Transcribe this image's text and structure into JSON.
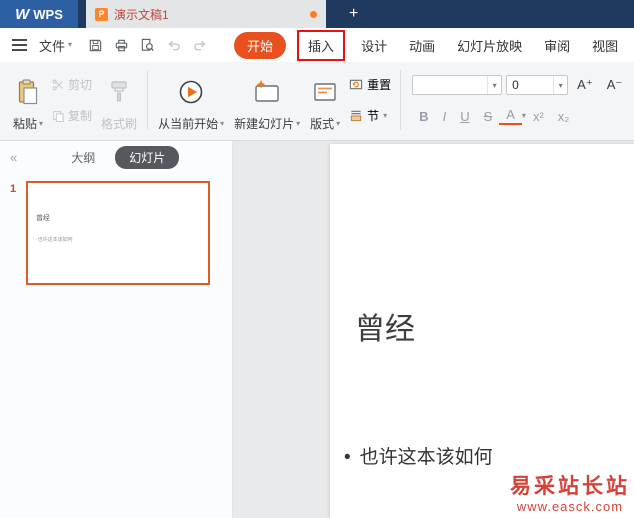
{
  "icons": {
    "logo_w": "W",
    "presentation_glyph": "P",
    "plus": "+",
    "dropdown_arrow": "▾",
    "collapse": "«"
  },
  "titlebar": {
    "logo_text": "WPS",
    "tab_title": "演示文稿1"
  },
  "menubar": {
    "file_label": "文件",
    "tabs": [
      {
        "label": "开始"
      },
      {
        "label": "插入"
      },
      {
        "label": "设计"
      },
      {
        "label": "动画"
      },
      {
        "label": "幻灯片放映"
      },
      {
        "label": "审阅"
      },
      {
        "label": "视图"
      }
    ]
  },
  "ribbon": {
    "paste": "粘贴",
    "cut": "剪切",
    "copy": "复制",
    "format_painter": "格式刷",
    "play_from_current": "从当前开始",
    "new_slide": "新建幻灯片",
    "layout": "版式",
    "reset": "重置",
    "section": "节",
    "font_family_value": "",
    "font_size_value": "0",
    "increase_font": "A⁺",
    "decrease_font": "A⁻",
    "bold": "B",
    "italic": "I",
    "underline": "U",
    "strikethrough": "S",
    "font_color": "A",
    "superscript": "x²",
    "subscript": "x₂"
  },
  "sidebar": {
    "outline_tab": "大纲",
    "slides_tab": "幻灯片",
    "slide_number": "1",
    "thumb_title": "曾经",
    "thumb_bullet": "·也许这本该如何"
  },
  "slide": {
    "title": "曾经",
    "bullet_marker": "•",
    "bullet": "也许这本该如何"
  },
  "watermark": {
    "line1": "易采站长站",
    "line2": "www.easck.com"
  }
}
